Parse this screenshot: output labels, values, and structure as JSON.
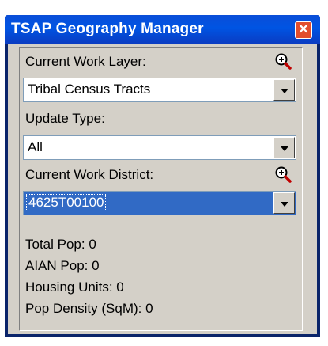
{
  "window": {
    "title": "TSAP Geography Manager",
    "close_label": "✕"
  },
  "layer": {
    "label": "Current Work Layer:",
    "value": "Tribal Census Tracts",
    "zoom_icon": "zoom-in-icon"
  },
  "update": {
    "label": "Update Type:",
    "value": "All"
  },
  "district": {
    "label": "Current Work District:",
    "value": "4625T00100",
    "zoom_icon": "zoom-in-icon"
  },
  "stats": {
    "total_pop": "Total Pop: 0",
    "aian_pop": "AIAN Pop: 0",
    "housing_units": "Housing Units:  0",
    "pop_density": "Pop Density (SqM): 0"
  },
  "colors": {
    "titlebar": "#0054e3",
    "selection": "#316ac5",
    "panel": "#d4d0c8",
    "close": "#e24e2e"
  }
}
